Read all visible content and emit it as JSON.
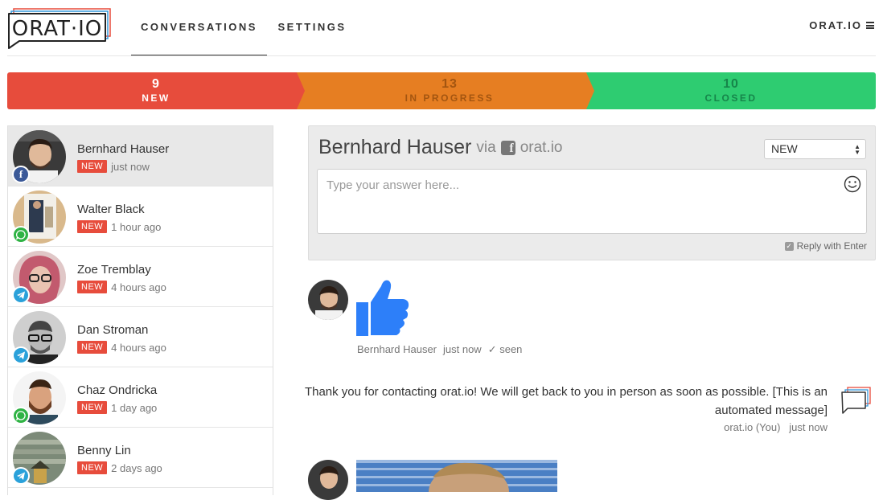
{
  "app": {
    "logo_text": "ORAT·IO",
    "nav": [
      {
        "label": "CONVERSATIONS",
        "active": true
      },
      {
        "label": "SETTINGS",
        "active": false
      }
    ],
    "account_label": "ORAT.IO"
  },
  "status_bar": [
    {
      "count": "9",
      "label": "NEW",
      "color": "#e74c3c"
    },
    {
      "count": "13",
      "label": "IN PROGRESS",
      "color": "#e67e22"
    },
    {
      "count": "10",
      "label": "CLOSED",
      "color": "#2ecc71"
    }
  ],
  "conversations": [
    {
      "name": "Bernhard Hauser",
      "badge": "NEW",
      "time": "just now",
      "channel": "facebook",
      "active": true
    },
    {
      "name": "Walter Black",
      "badge": "NEW",
      "time": "1 hour ago",
      "channel": "whatsapp",
      "active": false
    },
    {
      "name": "Zoe Tremblay",
      "badge": "NEW",
      "time": "4 hours ago",
      "channel": "telegram",
      "active": false
    },
    {
      "name": "Dan Stroman",
      "badge": "NEW",
      "time": "4 hours ago",
      "channel": "telegram",
      "active": false
    },
    {
      "name": "Chaz Ondricka",
      "badge": "NEW",
      "time": "1 day ago",
      "channel": "whatsapp",
      "active": false
    },
    {
      "name": "Benny Lin",
      "badge": "NEW",
      "time": "2 days ago",
      "channel": "telegram",
      "active": false
    }
  ],
  "composer": {
    "contact_name": "Bernhard Hauser",
    "via": "via",
    "source": "orat.io",
    "status_value": "NEW",
    "placeholder": "Type your answer here...",
    "reply_with_enter": "Reply with Enter"
  },
  "messages": {
    "first": {
      "author": "Bernhard Hauser",
      "time": "just now",
      "seen": "✓ seen"
    },
    "auto_reply": {
      "text": "Thank you for contacting orat.io! We will get back to you in person as soon as possible. [This is an automated message]",
      "author": "orat.io (You)",
      "time": "just now"
    }
  },
  "colors": {
    "new": "#e74c3c",
    "in_progress": "#e67e22",
    "closed": "#2ecc71",
    "facebook": "#3b5998",
    "whatsapp": "#2fb344",
    "telegram": "#2aa1da",
    "thumbs_up": "#2d7ff9"
  }
}
